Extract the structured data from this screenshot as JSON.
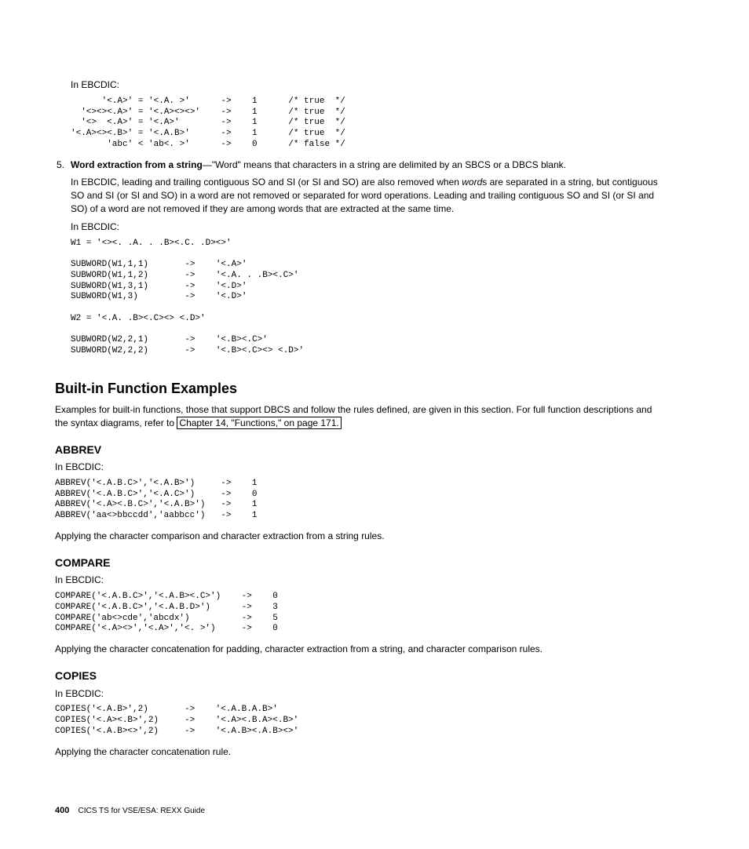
{
  "intro_label": "In EBCDIC:",
  "code1": "      '<.A>' = '<.A. >'      ->    1      /* true  */\n  '<><><.A>' = '<.A><><>'    ->    1      /* true  */\n  '<>  <.A>' = '<.A>'        ->    1      /* true  */\n'<.A><><.B>' = '<.A.B>'      ->    1      /* true  */\n       'abc' < 'ab<. >'      ->    0      /* false */",
  "list5": {
    "num": "5.",
    "bold": "Word extraction from a string",
    "dash": "—\"Word\" means that characters in a string are delimited by an SBCS or a DBCS blank.",
    "para": "In EBCDIC, leading and trailing contiguous SO and SI (or SI and SO) are also removed when ",
    "word_italic": "word",
    "para_after": "s are separated in a string, but contiguous SO and SI (or SI and SO) in a word are not removed or separated for word operations. Leading and trailing contiguous SO and SI (or SI and SO) of a word are not removed if they are among words that are extracted at the same time.",
    "label": "In EBCDIC:",
    "code": "W1 = '<><. .A. . .B><.C. .D><>'\n\nSUBWORD(W1,1,1)       ->    '<.A>'\nSUBWORD(W1,1,2)       ->    '<.A. . .B><.C>'\nSUBWORD(W1,3,1)       ->    '<.D>'\nSUBWORD(W1,3)         ->    '<.D>'\n\nW2 = '<.A. .B><.C><> <.D>'\n\nSUBWORD(W2,2,1)       ->    '<.B><.C>'\nSUBWORD(W2,2,2)       ->    '<.B><.C><> <.D>'"
  },
  "bif": {
    "title": "Built-in Function Examples",
    "intro_pre": "Examples for built-in functions, those that support DBCS and follow the rules defined, are given in this section. For full function descriptions and the syntax diagrams, refer to ",
    "link": "Chapter 14, \"Functions,\" on page 171."
  },
  "abbrev": {
    "title": "ABBREV",
    "label": "In EBCDIC:",
    "code": "ABBREV('<.A.B.C>','<.A.B>')     ->    1\nABBREV('<.A.B.C>','<.A.C>')     ->    0\nABBREV('<.A><.B.C>','<.A.B>')   ->    1\nABBREV('aa<>bbccdd','aabbcc')   ->    1",
    "note": "Applying the character comparison and character extraction from a string rules."
  },
  "compare": {
    "title": "COMPARE",
    "label": "In EBCDIC:",
    "code": "COMPARE('<.A.B.C>','<.A.B><.C>')    ->    0\nCOMPARE('<.A.B.C>','<.A.B.D>')      ->    3\nCOMPARE('ab<>cde','abcdx')          ->    5\nCOMPARE('<.A><>','<.A>','<. >')     ->    0",
    "note": "Applying the character concatenation for padding, character extraction from a string, and character comparison rules."
  },
  "copies": {
    "title": "COPIES",
    "label": "In EBCDIC:",
    "code": "COPIES('<.A.B>',2)       ->    '<.A.B.A.B>'\nCOPIES('<.A><.B>',2)     ->    '<.A><.B.A><.B>'\nCOPIES('<.A.B><>',2)     ->    '<.A.B><.A.B><>'",
    "note": "Applying the character concatenation rule."
  },
  "footer": {
    "page": "400",
    "text": "CICS TS for VSE/ESA:  REXX Guide"
  }
}
